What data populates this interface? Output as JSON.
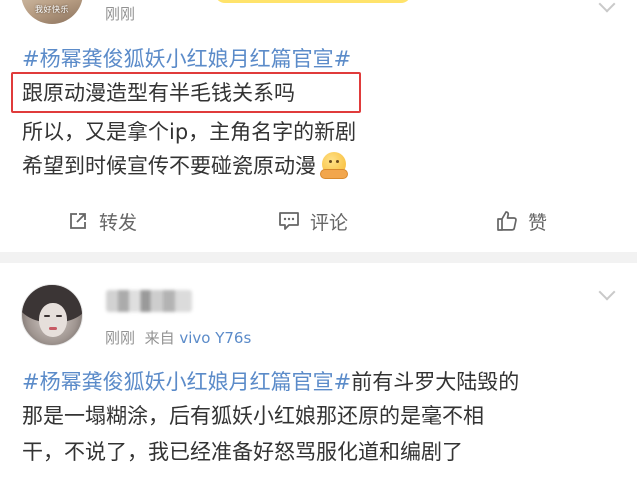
{
  "post1": {
    "avatar_caption": "我好快乐",
    "time": "刚刚",
    "lines": [
      {
        "topic": "#杨幂龚俊狐妖小红娘月红篇官宣#",
        "text": ""
      },
      {
        "topic": "",
        "text": "跟原动漫造型有半毛钱关系吗"
      },
      {
        "topic": "",
        "text": "所以，又是拿个ip，主角名字的新剧"
      },
      {
        "topic": "",
        "text": "希望到时候宣传不要碰瓷原动漫"
      }
    ],
    "emoji_icon": "pleading-face-icon",
    "actions": {
      "repost_label": "转发",
      "repost_icon": "share-icon",
      "comment_label": "评论",
      "comment_icon": "comment-icon",
      "like_label": "赞",
      "like_icon": "thumbs-up-icon"
    }
  },
  "post2": {
    "time": "刚刚",
    "source_prefix": "来自",
    "device": "vivo Y76s",
    "lines": [
      {
        "topic": "#杨幂龚俊狐妖小红娘月红篇官宣#",
        "text": "前有斗罗大陆毁的"
      },
      {
        "topic": "",
        "text": "那是一塌糊涂，后有狐妖小红娘那还原的是毫不相"
      },
      {
        "topic": "",
        "text": "干，不说了，我已经准备好怒骂服化道和编剧了"
      }
    ]
  },
  "colors": {
    "topic_blue": "#5b8bc9",
    "highlight_red": "#e03b3b",
    "meta_gray": "#939393",
    "text_dark": "#333333",
    "divider_gray": "#f2f2f2"
  }
}
